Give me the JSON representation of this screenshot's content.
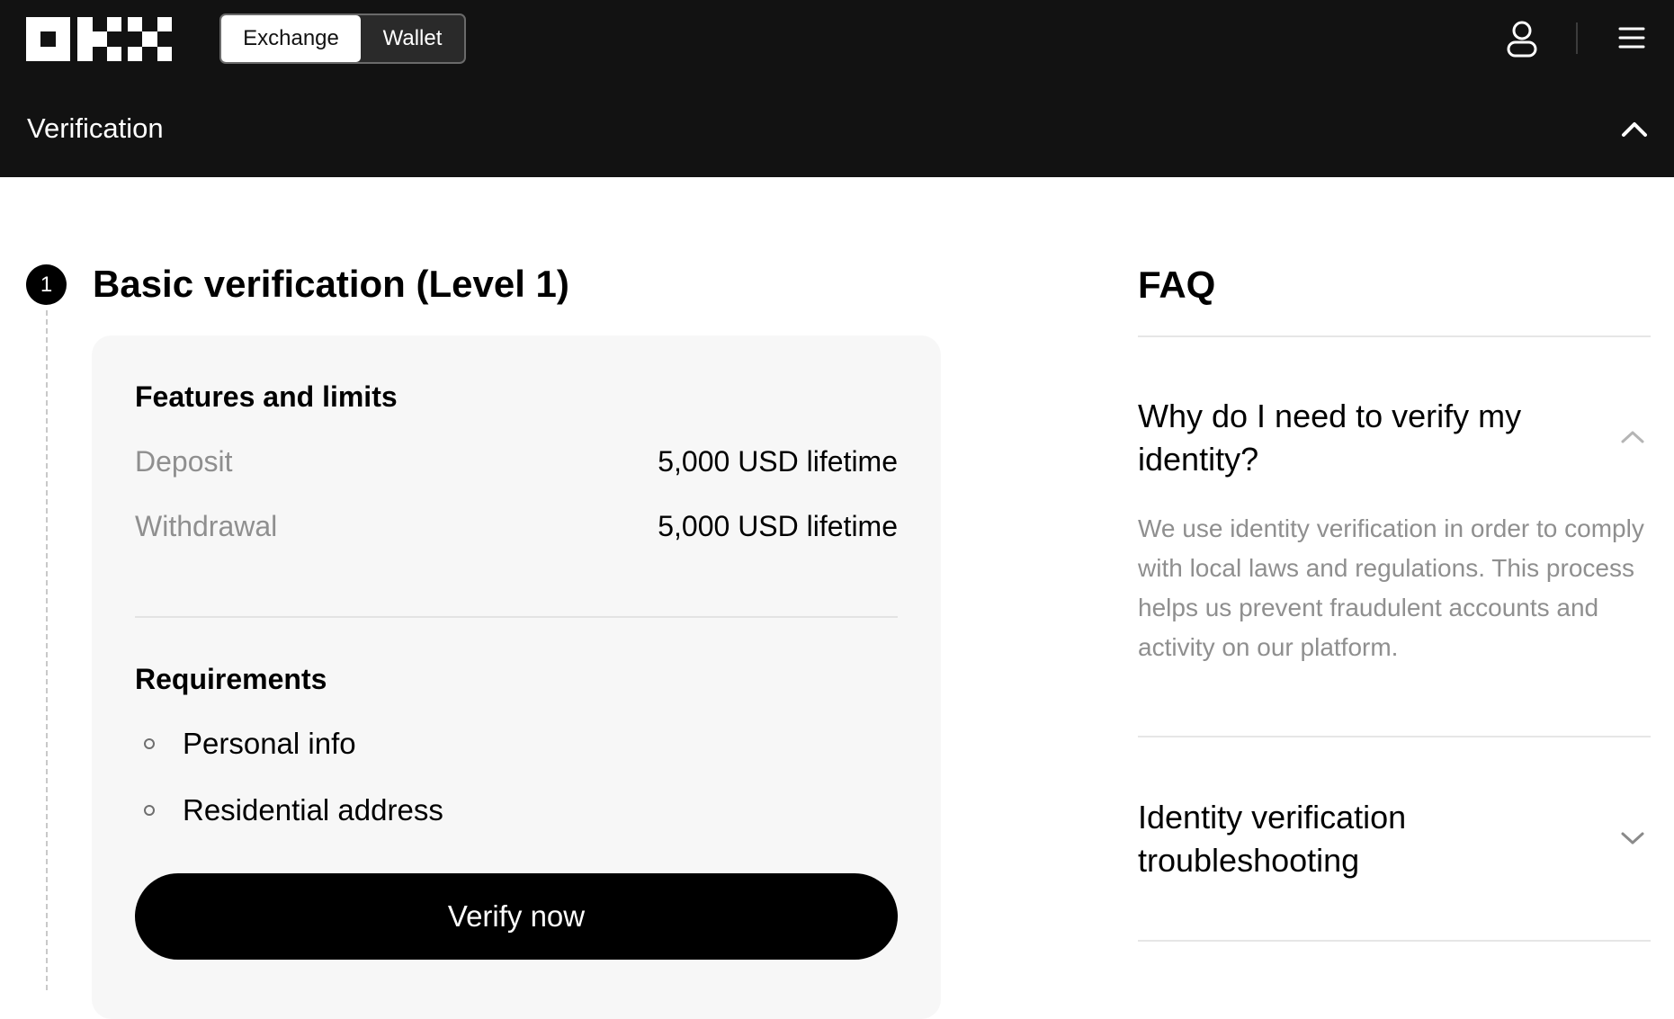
{
  "header": {
    "logo_icon": "okx-logo",
    "toggle": {
      "exchange_label": "Exchange",
      "wallet_label": "Wallet",
      "selected": "Exchange"
    },
    "user_icon": "user-icon",
    "menu_icon": "hamburger-menu-icon"
  },
  "subnav": {
    "title": "Verification",
    "toggle_icon": "chevron-up-icon"
  },
  "step": {
    "number": "1",
    "title": "Basic verification (Level 1)"
  },
  "card": {
    "features_title": "Features and limits",
    "limits": [
      {
        "label": "Deposit",
        "value": "5,000 USD lifetime"
      },
      {
        "label": "Withdrawal",
        "value": "5,000 USD lifetime"
      }
    ],
    "requirements_title": "Requirements",
    "requirements": [
      "Personal info",
      "Residential address"
    ],
    "verify_label": "Verify now"
  },
  "faq": {
    "heading": "FAQ",
    "items": [
      {
        "question": "Why do I need to verify my identity?",
        "answer": "We use identity verification in order to comply with local laws and regulations. This process helps us prevent fraudulent accounts and activity on our platform.",
        "expanded": true
      },
      {
        "question": "Identity verification troubleshooting",
        "expanded": false
      }
    ]
  },
  "colors": {
    "header_bg": "#121212",
    "card_bg": "#f7f7f7",
    "muted_text": "#8f8f8f",
    "primary_button": "#000000"
  }
}
